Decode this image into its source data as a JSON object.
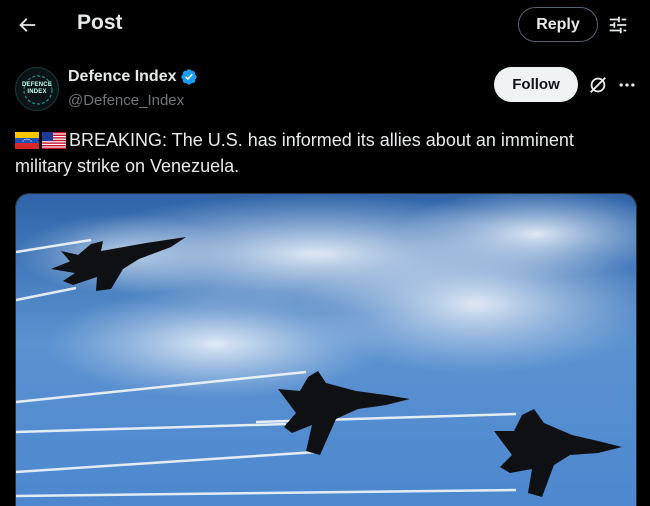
{
  "header": {
    "title": "Post",
    "reply_label": "Reply"
  },
  "author": {
    "display_name": "Defence Index",
    "handle": "@Defence_Index",
    "verified": true,
    "avatar_text": [
      "DEFENCE",
      "INDEX"
    ]
  },
  "actions": {
    "follow_label": "Follow"
  },
  "tweet": {
    "text": "BREAKING: The U.S. has informed its allies about an imminent military strike on Venezuela.",
    "flags": [
      "venezuela-flag",
      "us-flag"
    ]
  },
  "media": {
    "description_icon": "photo"
  },
  "colors": {
    "background": "#000000",
    "text": "#e7e9ea",
    "muted": "#71767b",
    "verified": "#1d9bf0",
    "follow_bg": "#eff3f4"
  }
}
